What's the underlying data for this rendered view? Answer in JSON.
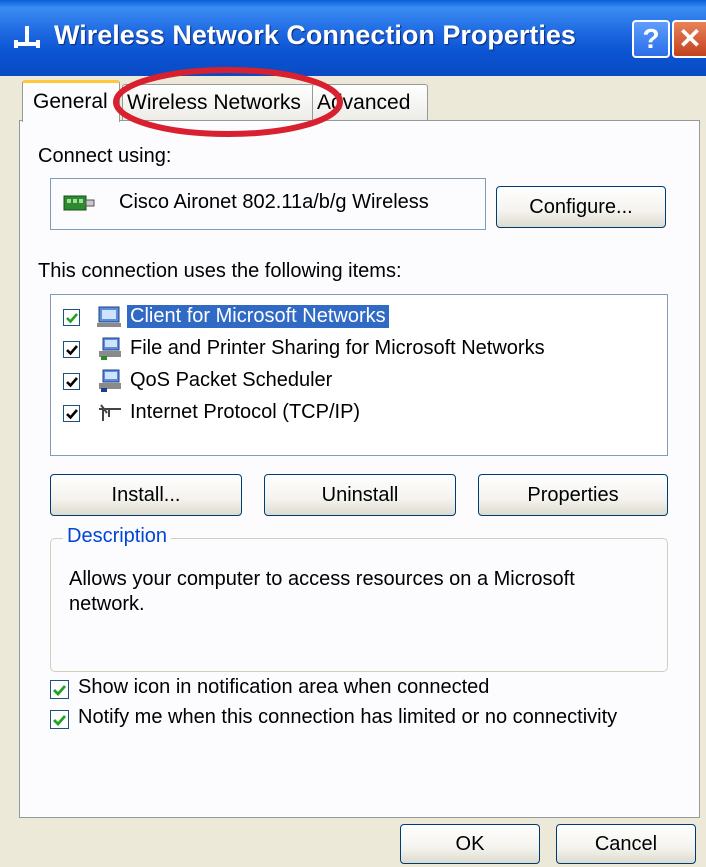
{
  "window": {
    "title": "Wireless Network Connection Properties",
    "help_label": "?",
    "close_label": "✕"
  },
  "tabs": [
    {
      "label": "General",
      "selected": true
    },
    {
      "label": "Wireless Networks",
      "selected": false,
      "highlighted": true
    },
    {
      "label": "Advanced",
      "selected": false
    }
  ],
  "general": {
    "connect_using_label": "Connect using:",
    "device_name": "Cisco Aironet 802.11a/b/g Wireless",
    "configure_label": "Configure...",
    "items_label": "This connection uses the following items:",
    "items": [
      {
        "label": "Client for Microsoft Networks",
        "checked": true,
        "selected": true,
        "icon": "network-client-icon"
      },
      {
        "label": "File and Printer Sharing for Microsoft Networks",
        "checked": true,
        "selected": false,
        "icon": "file-printer-sharing-icon"
      },
      {
        "label": "QoS Packet Scheduler",
        "checked": true,
        "selected": false,
        "icon": "qos-scheduler-icon"
      },
      {
        "label": "Internet Protocol (TCP/IP)",
        "checked": true,
        "selected": false,
        "icon": "network-protocol-icon"
      }
    ],
    "install_label": "Install...",
    "uninstall_label": "Uninstall",
    "properties_label": "Properties",
    "description_title": "Description",
    "description_text": "Allows your computer to access resources on a Microsoft network.",
    "show_icon_label": "Show icon in notification area when connected",
    "show_icon_checked": true,
    "notify_label": "Notify me when this connection has limited or no connectivity",
    "notify_checked": true
  },
  "footer": {
    "ok_label": "OK",
    "cancel_label": "Cancel"
  },
  "colors": {
    "titlebar": "#0b53d1",
    "selection": "#316ac5",
    "annotation": "#d9202f",
    "group_title": "#0046d5"
  }
}
